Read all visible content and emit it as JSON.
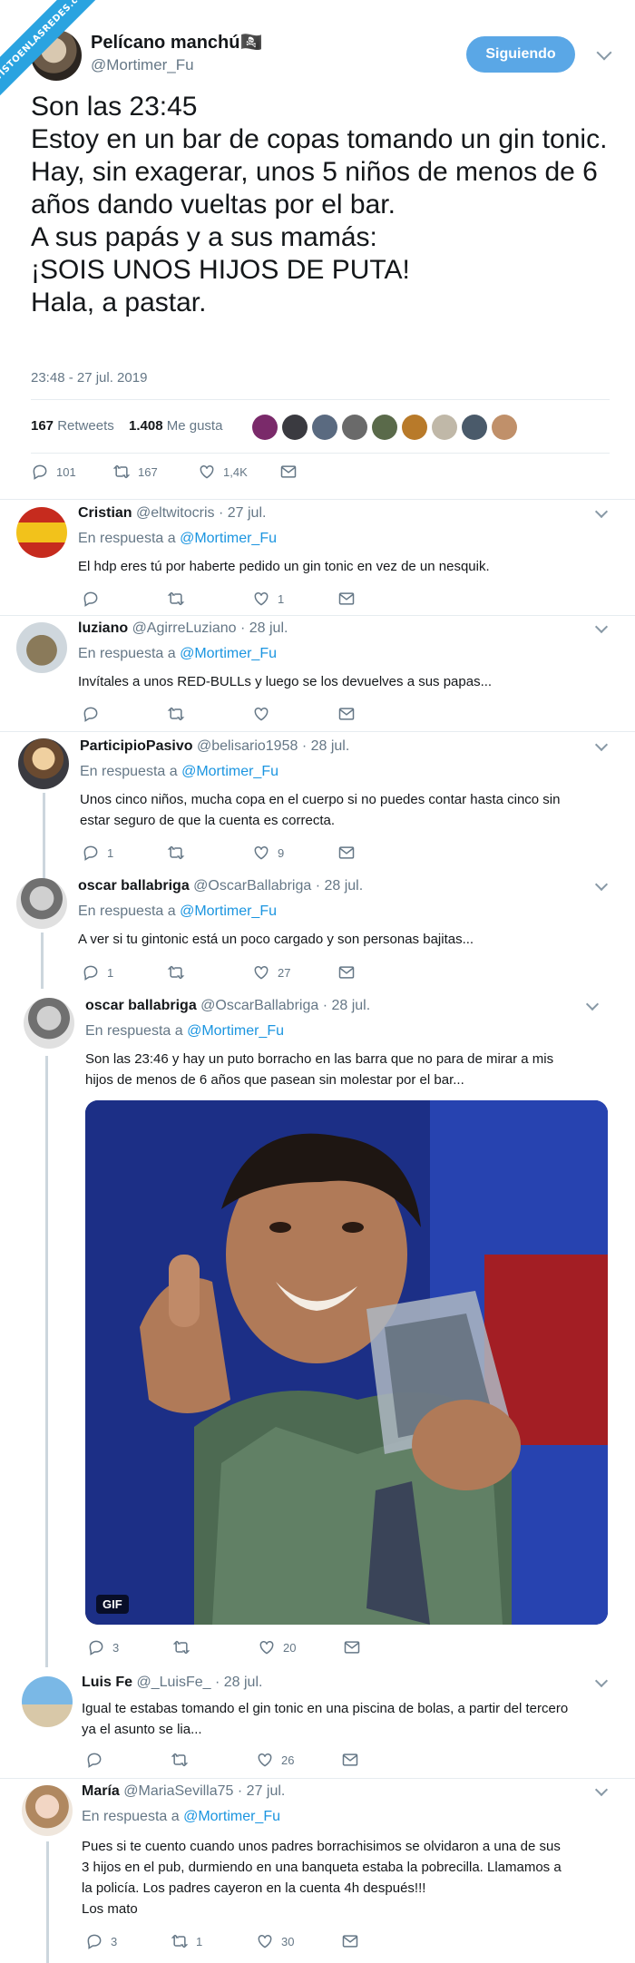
{
  "watermark": "VISTOENLASREDES.com",
  "main": {
    "name": "Pelícano manchú🏴‍☠️",
    "handle": "@Mortimer_Fu",
    "follow_label": "Siguiendo",
    "text": "Son las 23:45\nEstoy en un bar de copas tomando un gin tonic.\nHay, sin exagerar, unos 5 niños de menos de 6 años dando vueltas por el bar.\nA sus papás y a sus mamás:\n¡SOIS UNOS HIJOS DE PUTA!\nHala, a pastar.",
    "timestamp": "23:48 - 27 jul. 2019",
    "retweets_count": "167",
    "retweets_label": "Retweets",
    "likes_count": "1.408",
    "likes_label": "Me gusta",
    "actions": {
      "replies": "101",
      "retweets": "167",
      "likes": "1,4K"
    }
  },
  "replies": [
    {
      "name": "Cristian",
      "handle": "@eltwitocris",
      "date": "· 27 jul.",
      "resp_prefix": "En respuesta a",
      "resp_user": "@Mortimer_Fu",
      "body": "El hdp eres tú por haberte pedido un gin tonic en vez de un nesquik.",
      "replies": "",
      "retweets": "",
      "likes": "1"
    },
    {
      "name": "luziano",
      "handle": "@AgirreLuziano",
      "date": "· 28 jul.",
      "resp_prefix": "En respuesta a",
      "resp_user": "@Mortimer_Fu",
      "body": "Invítales a unos RED-BULLs y luego se los devuelves a sus papas...",
      "replies": "",
      "retweets": "",
      "likes": ""
    },
    {
      "name": "ParticipioPasivo",
      "handle": "@belisario1958",
      "date": "· 28 jul.",
      "resp_prefix": "En respuesta a",
      "resp_user": "@Mortimer_Fu",
      "body": "Unos cinco niños, mucha copa en el cuerpo si no puedes contar hasta cinco sin\nestar seguro de que la cuenta es correcta.",
      "replies": "1",
      "retweets": "",
      "likes": "9"
    },
    {
      "name": "oscar ballabriga",
      "handle": "@OscarBallabriga",
      "date": "· 28 jul.",
      "resp_prefix": "En respuesta a",
      "resp_user": "@Mortimer_Fu",
      "body": "A ver si tu gintonic está un poco cargado y son personas bajitas...",
      "replies": "1",
      "retweets": "",
      "likes": "27"
    },
    {
      "name": "oscar ballabriga",
      "handle": "@OscarBallabriga",
      "date": "· 28 jul.",
      "resp_prefix": "En respuesta a",
      "resp_user": "@Mortimer_Fu",
      "body": "Son las 23:46 y hay un puto borracho en las barra que no para de mirar a mis\nhijos de menos de 6 años que pasean sin molestar por el bar...",
      "gif_label": "GIF",
      "replies": "3",
      "retweets": "",
      "likes": "20"
    },
    {
      "name": "Luis Fe",
      "handle": "@_LuisFe_",
      "date": "· 28 jul.",
      "resp_prefix": "",
      "resp_user": "",
      "body": "Igual te estabas tomando el gin tonic en una piscina de bolas, a partir del tercero\nya el asunto se lia...",
      "replies": "",
      "retweets": "",
      "likes": "26"
    },
    {
      "name": "María",
      "handle": "@MariaSevilla75",
      "date": "· 27 jul.",
      "resp_prefix": "En respuesta a",
      "resp_user": "@Mortimer_Fu",
      "body": "Pues si te cuento cuando unos padres borrachisimos se olvidaron a una de sus\n3 hijos en el pub, durmiendo en una banqueta estaba la pobrecilla. Llamamos a\nla policía. Los padres cayeron en la cuenta 4h después!!!\nLos mato",
      "replies": "3",
      "retweets": "1",
      "likes": "30"
    }
  ],
  "colors": {
    "accent": "#1b95e0",
    "follow_button": "#5aa7e6",
    "muted": "#657786"
  }
}
